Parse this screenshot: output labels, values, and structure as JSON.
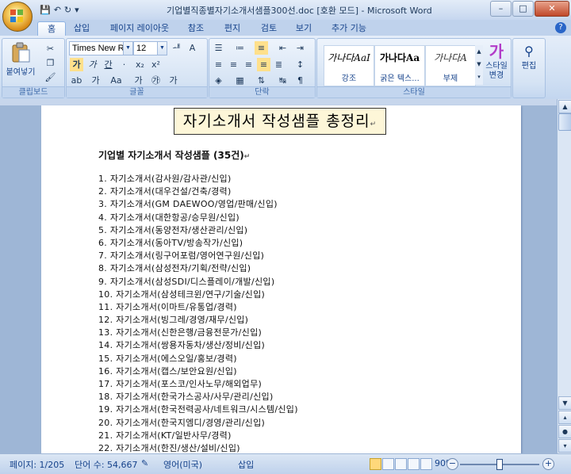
{
  "window": {
    "title": "기업별직종별자기소개서샘플300선.doc [호환 모드] - Microsoft Word",
    "controls": {
      "minimize": "–",
      "maximize": "□",
      "close": "✕"
    }
  },
  "qat": {
    "save": "💾",
    "undo": "↶",
    "redo": "↻",
    "more": "▾"
  },
  "tabs": [
    "홈",
    "삽입",
    "페이지 레이아웃",
    "참조",
    "편지",
    "검토",
    "보기",
    "추가 기능"
  ],
  "ribbon": {
    "clipboard": {
      "label": "클립보드",
      "paste": "붙여넣기"
    },
    "font": {
      "label": "글꼴",
      "font_name": "Times New Ro",
      "font_size": "12",
      "row2": [
        "가",
        "가",
        "간",
        "·",
        "x₂",
        "x²"
      ],
      "row3": [
        "가",
        "Aa",
        "가",
        "㉮",
        "가"
      ]
    },
    "paragraph": {
      "label": "단락"
    },
    "styles": {
      "label": "스타일",
      "items": [
        {
          "sample": "가나다AaI",
          "name": "강조"
        },
        {
          "sample": "가나다Aa",
          "name": "굵은 텍스..."
        },
        {
          "sample": "가나다A",
          "name": "부제"
        }
      ],
      "change": "스타일 변경"
    },
    "editing": {
      "label": "편집"
    }
  },
  "document": {
    "title": "자기소개서 작성샘플 총정리",
    "heading": "기업별 자기소개서 작성샘플 (35건)",
    "items": [
      "1. 자기소개서(감사원/감사관/신입)",
      "2. 자기소개서(대우건설/건축/경력)",
      "3. 자기소개서(GM DAEWOO/영업/판매/신입)",
      "4. 자기소개서(대한항공/승무원/신입)",
      "5. 자기소개서(동양전자/생산관리/신입)",
      "6. 자기소개서(동아TV/방송작가/신입)",
      "7. 자기소개서(링구어포럼/영어연구원/신입)",
      "8. 자기소개서(삼성전자/기획/전략/신입)",
      "9. 자기소개서(삼성SDI/디스플레이/개발/신입)",
      "10. 자기소개서(삼성테크윈/연구/기술/신입)",
      "11. 자기소개서(이마트/유통업/경력)",
      "12. 자기소개서(빙그레/경영/재무/신입)",
      "13. 자기소개서(신한은행/금융전문가/신입)",
      "14. 자기소개서(쌍용자동차/생산/정비/신입)",
      "15. 자기소개서(에스오일/홍보/경력)",
      "16. 자기소개서(캡스/보안요원/신입)",
      "17. 자기소개서(포스코/인사노무/해외업무)",
      "18. 자기소개서(한국가스공사/사무/관리/신입)",
      "19. 자기소개서(한국전력공사/네트워크/시스템/신입)",
      "20. 자기소개서(한국지엠디/경영/관리/신입)",
      "21. 자기소개서(KT/일반사무/경력)",
      "22. 자기소개서(한진/생산/설비/신입)"
    ]
  },
  "status": {
    "page": "페이지: 1/205",
    "words": "단어 수: 54,667",
    "language": "영어(미국)",
    "mode": "삽입",
    "zoom": "90%"
  }
}
